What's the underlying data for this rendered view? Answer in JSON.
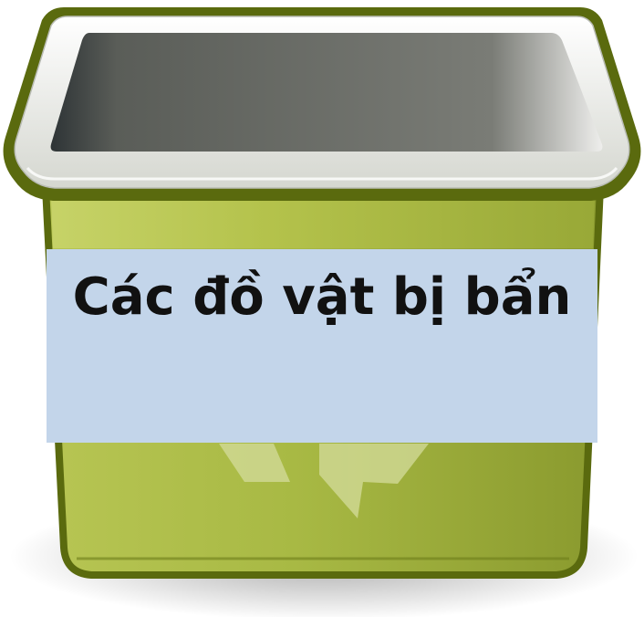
{
  "label": {
    "text": "Các đồ vật bị bẩn",
    "background": "#c3d5ea"
  },
  "bin": {
    "icon": "recycle-bin-icon",
    "body_color": "#a4b441",
    "outline_color": "#5a6a0e",
    "rim_color": "#f2f3ef",
    "interior_color": "#6f716b"
  }
}
